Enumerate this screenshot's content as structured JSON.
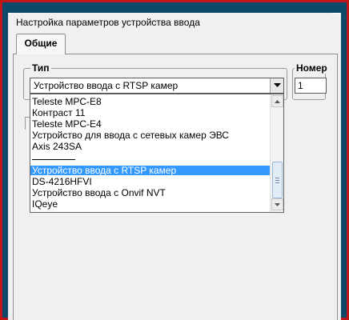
{
  "dialog": {
    "title": "Настройка параметров устройства ввода"
  },
  "tabs": [
    {
      "label": "Общие",
      "active": true
    }
  ],
  "type_group": {
    "label": "Тип",
    "selected_value": "Устройство ввода с RTSP камер"
  },
  "number_group": {
    "label": "Номер",
    "value": "1"
  },
  "dropdown": {
    "items": [
      {
        "label": "Teleste MPC-E8",
        "selected": false
      },
      {
        "label": "Контраст 11",
        "selected": false
      },
      {
        "label": "Teleste MPC-E4",
        "selected": false
      },
      {
        "label": "Устройство для ввода с сетевых камер ЭВС",
        "selected": false
      },
      {
        "label": "Axis 243SA",
        "selected": false
      },
      {
        "label": "",
        "separator": true
      },
      {
        "label": "Устройство ввода с RTSP камер",
        "selected": true
      },
      {
        "label": "DS-4216HFVI",
        "selected": false
      },
      {
        "label": "Устройство ввода с Onvif NVT",
        "selected": false
      },
      {
        "label": "IQeye",
        "selected": false
      }
    ]
  },
  "icons": {
    "combo_arrow": "chevron-down-icon",
    "scroll_up": "scroll-up-icon",
    "scroll_down": "scroll-down-icon"
  },
  "colors": {
    "selection": "#3399ff",
    "frame_border": "#c0181a",
    "background": "#0d4a6a"
  }
}
